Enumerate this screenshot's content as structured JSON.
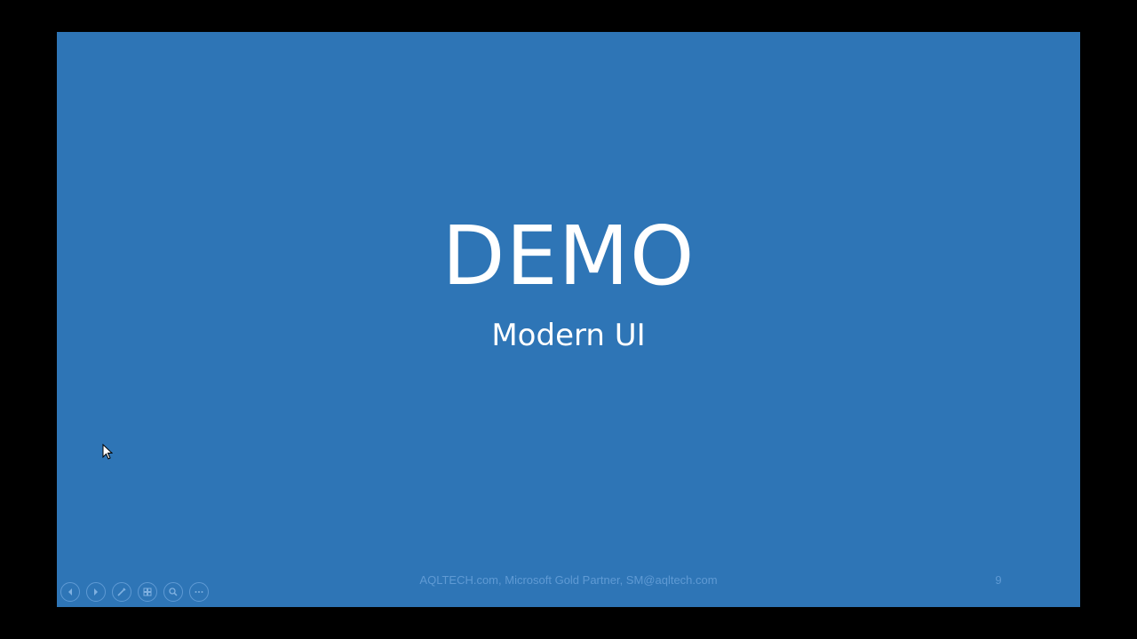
{
  "slide": {
    "title": "DEMO",
    "subtitle": "Modern UI",
    "footer": "AQLTECH.com, Microsoft Gold Partner, SM@aqltech.com",
    "page_number": "9",
    "background_color": "#2e75b6",
    "text_color": "#ffffff",
    "footer_color": "#5f9ad4"
  },
  "controls": [
    {
      "name": "previous-slide-button",
      "icon": "chevron-left-icon"
    },
    {
      "name": "next-slide-button",
      "icon": "chevron-right-icon"
    },
    {
      "name": "pen-tool-button",
      "icon": "pen-icon"
    },
    {
      "name": "see-all-slides-button",
      "icon": "grid-icon"
    },
    {
      "name": "zoom-button",
      "icon": "magnifier-icon"
    },
    {
      "name": "more-options-button",
      "icon": "ellipsis-icon"
    }
  ]
}
